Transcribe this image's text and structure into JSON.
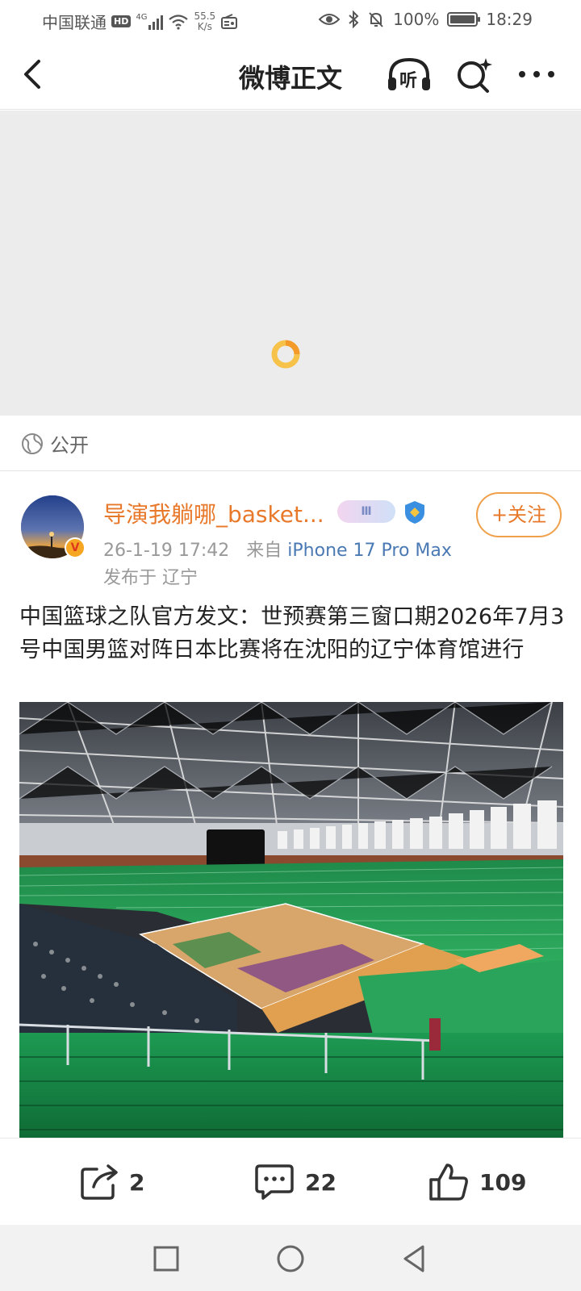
{
  "status_bar": {
    "carrier": "中国联通",
    "hd": "HD",
    "network": "4G",
    "speed_value": "55.5",
    "speed_unit": "K/s",
    "battery": "100%",
    "time": "18:29"
  },
  "nav": {
    "title": "微博正文",
    "listen_label": "听"
  },
  "visibility": {
    "label": "公开"
  },
  "post": {
    "username": "导演我躺哪_basket...",
    "member_level": "Ⅲ",
    "follow_label": "+关注",
    "timestamp": "26-1-19 17:42",
    "source_prefix": "来自",
    "source": "iPhone 17 Pro Max",
    "location": "发布于 辽宁",
    "text": "中国篮球之队官方发文：世预赛第三窗口期2026年7月3号中国男篮对阵日本比赛将在沈阳的辽宁体育馆进行",
    "avatar_badge": "V"
  },
  "actions": {
    "reposts": "2",
    "comments": "22",
    "likes": "109"
  },
  "colors": {
    "accent_orange": "#e8782a",
    "link_blue": "#4a79b4",
    "media_placeholder": "#ececec"
  }
}
